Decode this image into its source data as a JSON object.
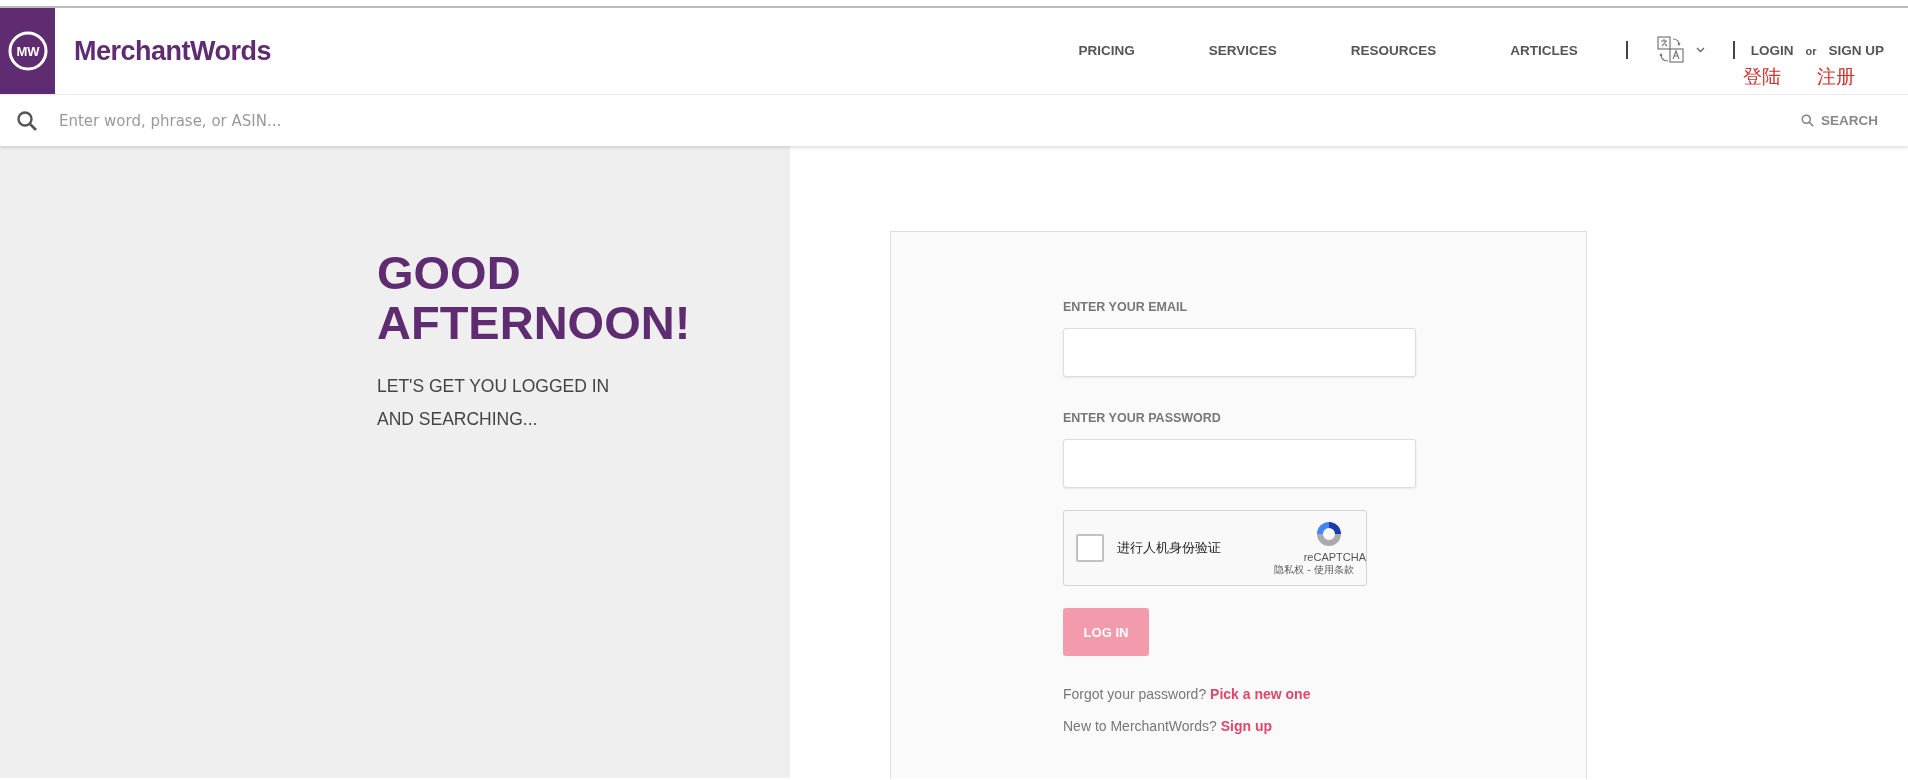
{
  "header": {
    "brand": "MerchantWords",
    "logo_letters": "MW",
    "nav": [
      {
        "label": "PRICING"
      },
      {
        "label": "SERVICES"
      },
      {
        "label": "RESOURCES"
      },
      {
        "label": "ARTICLES"
      }
    ],
    "auth": {
      "login": "LOGIN",
      "or": "or",
      "signup": "SIGN UP"
    },
    "annotations": [
      {
        "text": "登陆",
        "color": "#d0312d"
      },
      {
        "text": "注册",
        "color": "#d0312d"
      }
    ]
  },
  "search": {
    "placeholder": "Enter word, phrase, or ASIN...",
    "button": "SEARCH"
  },
  "greeting": {
    "title_lines": [
      "GOOD",
      "AFTERNOON!"
    ],
    "subtitle_lines": [
      "LET'S GET YOU LOGGED IN",
      "AND SEARCHING..."
    ]
  },
  "form": {
    "email_label": "ENTER YOUR EMAIL",
    "password_label": "ENTER YOUR PASSWORD",
    "captcha": {
      "label": "进行人机身份验证",
      "checked": false,
      "brand": "reCAPTCHA",
      "links": "隐私权 - 使用条款"
    },
    "login_button": {
      "label": "LOG IN",
      "disabled": true
    },
    "forgot": {
      "text": "Forgot your password?",
      "link": "Pick a new one"
    },
    "signup": {
      "text": "New to MerchantWords?",
      "link": "Sign up"
    }
  }
}
